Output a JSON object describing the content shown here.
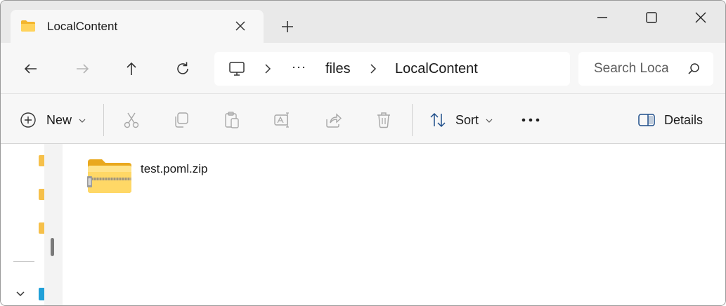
{
  "tab": {
    "title": "LocalContent",
    "new_tab_symbol": "+"
  },
  "window_controls": [
    "minimize",
    "maximize",
    "close"
  ],
  "nav": {
    "breadcrumb": [
      "files",
      "LocalContent"
    ],
    "overflow": "···",
    "search_placeholder": "Search Loca"
  },
  "commands": {
    "new_label": "New",
    "sort_label": "Sort",
    "details_label": "Details",
    "disabled": [
      "cut-icon",
      "copy-icon",
      "paste-icon",
      "rename-icon",
      "share-icon",
      "delete-icon"
    ]
  },
  "files": [
    {
      "name": "test.poml.zip",
      "icon": "zip-folder-icon"
    }
  ],
  "colors": {
    "folder_yellow": "#f6c04a",
    "accent": "#0067c0",
    "disabled_icon": "#a8a8a8"
  }
}
